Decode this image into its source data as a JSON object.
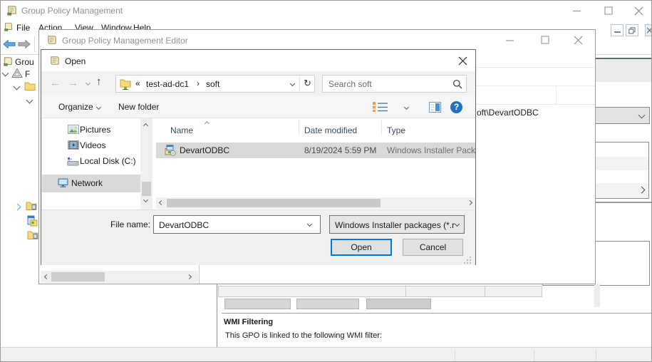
{
  "colors": {
    "accent": "#0078d7",
    "selection_gray": "#d9d9d9",
    "inactive_title": "#909090",
    "help_blue": "#2170c4"
  },
  "glyphs": {
    "help": "?",
    "overflow_chevron": "«",
    "crumb_separator": "›",
    "back_arrow": "←",
    "forward_arrow": "→",
    "up_arrow": "↑",
    "refresh": "↻"
  },
  "main_window": {
    "title": "Group Policy Management",
    "menu": {
      "file": "File",
      "action": "Action",
      "view": "View",
      "window": "Window",
      "help": "Help"
    },
    "tree": {
      "root": "Grou",
      "forest": "F"
    },
    "wmi": {
      "heading": "WMI Filtering",
      "description": "This GPO is linked to the following WMI filter:"
    }
  },
  "editor_window": {
    "title": "Group Policy Management Editor",
    "list_fragment": "oft\\DevartODBC"
  },
  "open_dialog": {
    "title": "Open",
    "breadcrumb": {
      "server": "test-ad-dc1",
      "folder": "soft"
    },
    "search_placeholder": "Search soft",
    "commands": {
      "organize": "Organize",
      "new_folder": "New folder"
    },
    "sidebar": {
      "pictures": "Pictures",
      "videos": "Videos",
      "local_disk": "Local Disk (C:)",
      "network": "Network"
    },
    "columns": {
      "name": "Name",
      "date_modified": "Date modified",
      "type": "Type"
    },
    "file": {
      "name": "DevartODBC",
      "date_modified": "8/19/2024 5:59 PM",
      "type": "Windows Installer Pack"
    },
    "footer": {
      "file_name_label": "File name:",
      "file_name_value": "DevartODBC",
      "file_type_value": "Windows Installer packages (*.r",
      "open": "Open",
      "cancel": "Cancel"
    }
  }
}
